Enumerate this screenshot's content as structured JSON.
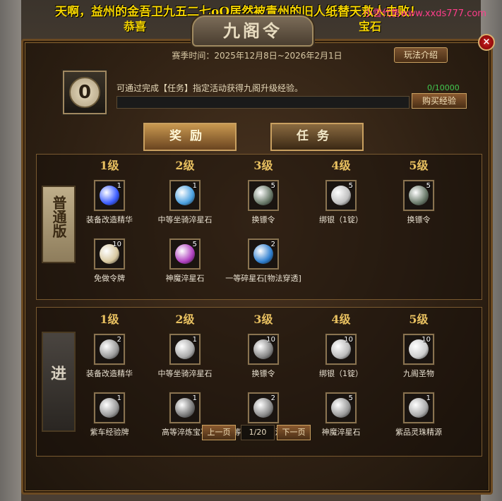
{
  "broadcast": {
    "line1": "天啊，益州的金吾卫九五二七oO居然被青州的旧人纸替天救人击败！",
    "line2_left": "恭喜",
    "line2_right": "宝石"
  },
  "watermark": "小雪代售www.xxds777.com",
  "window": {
    "title": "九阁令",
    "close": "×",
    "season": "赛季时间：2025年12月8日~2026年2月1日",
    "rules_button": "玩法介绍"
  },
  "experience": {
    "level": "0",
    "tip": "可通过完成【任务】指定活动获得九阁升级经验。",
    "value_text": "0/10000",
    "progress": 0,
    "buy_button": "购买经验"
  },
  "tabs": [
    {
      "label": "奖励",
      "active": true
    },
    {
      "label": "任务",
      "active": false
    }
  ],
  "levels": [
    "1级",
    "2级",
    "3级",
    "4级",
    "5级"
  ],
  "normal": {
    "emblem": "普通版",
    "items": [
      {
        "name": "装备改造精华",
        "qty": "1",
        "icon": "blue-orb-icon",
        "color": "#3a5cff"
      },
      {
        "name": "中等坐骑淬星石",
        "qty": "1",
        "icon": "star-stone-icon",
        "color": "#4aa0e0"
      },
      {
        "name": "换镖令",
        "qty": "5",
        "icon": "token-icon",
        "color": "#6a7a6a"
      },
      {
        "name": "绑银（1锭）",
        "qty": "5",
        "icon": "silver-ingot-icon",
        "color": "#c0c0c0"
      },
      {
        "name": "换镖令",
        "qty": "5",
        "icon": "token-icon",
        "color": "#6a7a6a"
      },
      {
        "name": "免做令牌",
        "qty": "10",
        "icon": "scroll-icon",
        "color": "#d8c8a0"
      },
      {
        "name": "神魔淬星石",
        "qty": "5",
        "icon": "purple-stone-icon",
        "color": "#b040c0"
      },
      {
        "name": "一等碎星石[物法穿透]",
        "qty": "2",
        "icon": "blue-stone-icon",
        "color": "#3080d0"
      }
    ]
  },
  "advanced": {
    "emblem": "进",
    "items": [
      {
        "name": "装备改造精华",
        "qty": "2",
        "icon": "grey-orb-icon",
        "color": "#9a9a9a"
      },
      {
        "name": "中等坐骑淬星石",
        "qty": "1",
        "icon": "grey-star-stone-icon",
        "color": "#aaaaaa"
      },
      {
        "name": "换镖令",
        "qty": "10",
        "icon": "grey-token-icon",
        "color": "#888888"
      },
      {
        "name": "绑银（1锭）",
        "qty": "10",
        "icon": "grey-silver-ingot-icon",
        "color": "#bbbbbb"
      },
      {
        "name": "九阁圣物",
        "qty": "10",
        "icon": "grey-scroll-icon",
        "color": "#cccccc"
      },
      {
        "name": "紫车经验牌",
        "qty": "1",
        "icon": "grey-card-icon",
        "color": "#999999"
      },
      {
        "name": "高等淬炼宝石",
        "qty": "1",
        "icon": "grey-gem-icon",
        "color": "#777777"
      },
      {
        "name": "一等碎星石[物法穿透]",
        "qty": "2",
        "icon": "grey-shard-icon",
        "color": "#8a8a8a"
      },
      {
        "name": "神魔淬星石",
        "qty": "5",
        "icon": "grey-stone-icon",
        "color": "#9a9a9a"
      },
      {
        "name": "紫品灵珠精源",
        "qty": "1",
        "icon": "grey-pearl-icon",
        "color": "#aaaaaa"
      }
    ]
  },
  "pagination": {
    "prev": "上一页",
    "page": "1/20",
    "next": "下一页"
  }
}
